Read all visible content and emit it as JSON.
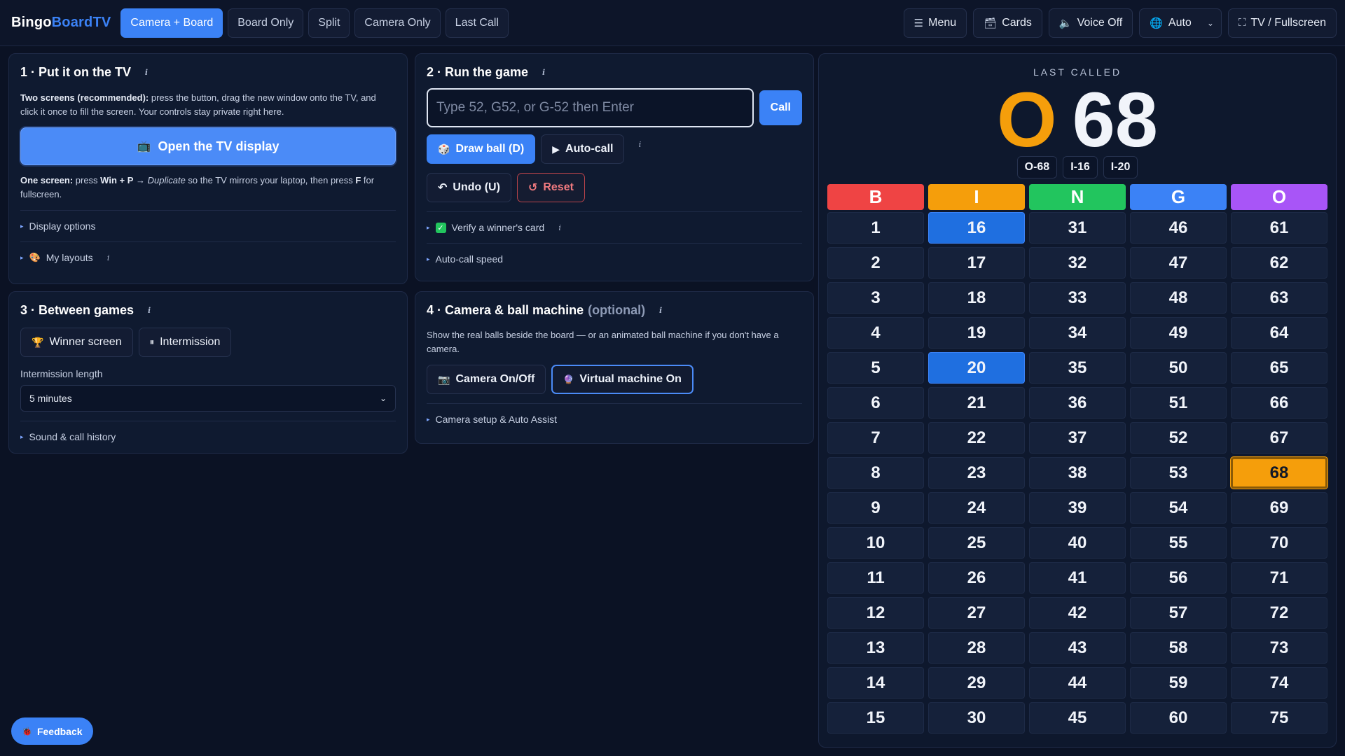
{
  "brand": {
    "part1": "Bingo",
    "part2": "BoardTV"
  },
  "tabs": [
    {
      "label": "Camera + Board",
      "active": true
    },
    {
      "label": "Board Only",
      "active": false
    },
    {
      "label": "Split",
      "active": false
    },
    {
      "label": "Camera Only",
      "active": false
    },
    {
      "label": "Last Call",
      "active": false
    }
  ],
  "top_actions": {
    "menu": {
      "icon": "menu-icon",
      "glyph": "☰",
      "label": "Menu"
    },
    "cards": {
      "icon": "cards-icon",
      "glyph": "🗃",
      "label": "Cards"
    },
    "voice": {
      "icon": "speaker-icon",
      "glyph": "🔈",
      "label": "Voice Off"
    },
    "language": {
      "icon": "globe-icon",
      "glyph": "🌐",
      "label": "Auto"
    },
    "fullscreen": {
      "icon": "fullscreen-icon",
      "glyph": "⛶",
      "label": "TV / Fullscreen"
    }
  },
  "panel1": {
    "title": "1 · Put it on the TV",
    "two_screens_bold": "Two screens (recommended):",
    "two_screens_text": " press the button, drag the new window onto the TV, and click it once to fill the screen. Your controls stay private right here.",
    "open_tv_button": "Open the TV display",
    "one_screen_bold": "One screen:",
    "one_screen_text_1": " press ",
    "one_screen_keys": "Win + P",
    "one_screen_arrow": " → ",
    "one_screen_duplicate": "Duplicate",
    "one_screen_text_2": " so the TV mirrors your laptop, then press ",
    "one_screen_f": "F",
    "one_screen_text_3": " for fullscreen.",
    "display_options": "Display options",
    "my_layouts": "My layouts"
  },
  "panel2": {
    "title": "2 · Run the game",
    "call_input_placeholder": "Type 52, G52, or G-52 then Enter",
    "call_button": "Call",
    "draw_ball": "Draw ball (D)",
    "auto_call": "Auto-call",
    "undo": "Undo (U)",
    "reset": "Reset",
    "verify_card": "Verify a winner's card",
    "auto_call_speed": "Auto-call speed"
  },
  "panel3": {
    "title": "3 · Between games",
    "winner_screen": "Winner screen",
    "intermission": "Intermission",
    "intermission_length_label": "Intermission length",
    "intermission_length_value": "5 minutes",
    "sound_history": "Sound & call history"
  },
  "panel4": {
    "title": "4 · Camera & ball machine",
    "title_optional": "(optional)",
    "description": "Show the real balls beside the board — or an animated ball machine if you don't have a camera.",
    "camera_toggle": "Camera On/Off",
    "virtual_machine": "Virtual machine On",
    "camera_setup": "Camera setup & Auto Assist"
  },
  "last_called": {
    "label": "LAST CALLED",
    "letter": "O",
    "number": "68",
    "recent": [
      "O-68",
      "I-16",
      "I-20"
    ]
  },
  "board": {
    "columns": [
      {
        "letter": "B",
        "color": "#ef4444"
      },
      {
        "letter": "I",
        "color": "#f59e0b"
      },
      {
        "letter": "N",
        "color": "#22c55e"
      },
      {
        "letter": "G",
        "color": "#3b82f6"
      },
      {
        "letter": "O",
        "color": "#a855f7"
      }
    ],
    "called": [
      16,
      20,
      68
    ],
    "last": 68
  },
  "feedback": "Feedback"
}
